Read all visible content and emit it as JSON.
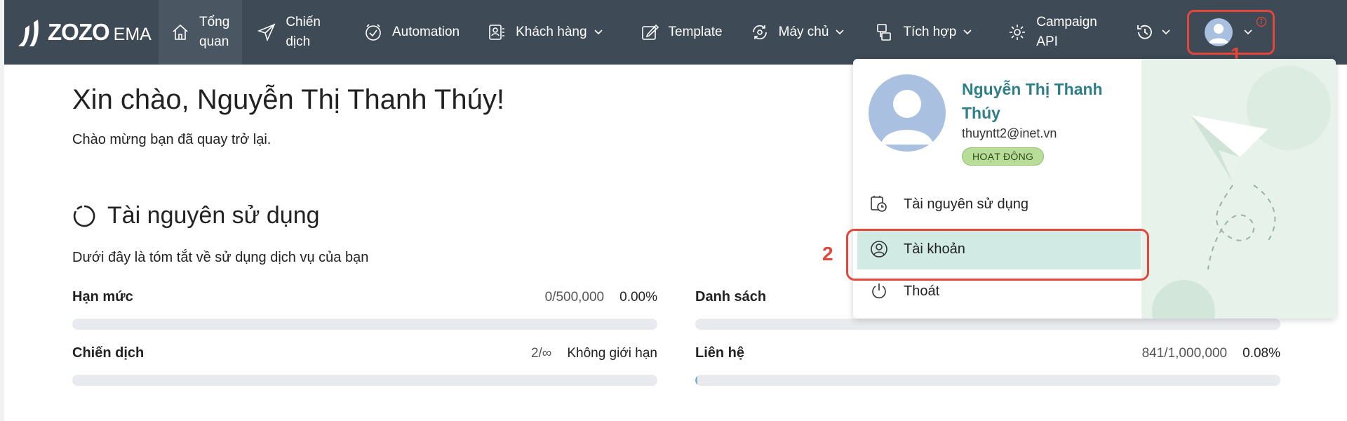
{
  "brand": {
    "name": "ZOZO",
    "suffix": "EMA"
  },
  "nav": [
    {
      "label": "Tổng\nquan",
      "line1": "Tổng",
      "line2": "quan",
      "icon": "home-icon",
      "active": true
    },
    {
      "label": "Chiến dịch",
      "line1": "Chiến",
      "line2": "dịch",
      "icon": "send-icon"
    },
    {
      "label": "Automation",
      "icon": "clock-check-icon"
    },
    {
      "label": "Khách hàng",
      "icon": "contacts-icon",
      "dropdown": true
    },
    {
      "label": "Template",
      "icon": "edit-icon"
    },
    {
      "label": "Máy chủ",
      "icon": "server-sync-icon",
      "dropdown": true
    },
    {
      "label": "Tích hợp",
      "icon": "integration-icon",
      "dropdown": true
    },
    {
      "label": "Campaign API",
      "line1": "Campaign",
      "line2": "API",
      "icon": "gear-api-icon"
    }
  ],
  "annotations": {
    "marker1": "1",
    "marker2": "2"
  },
  "greeting": "Xin chào, Nguyễn Thị Thanh Thúy!",
  "welcome": "Chào mừng bạn đã quay trở lại.",
  "resources": {
    "title": "Tài nguyên sử dụng",
    "description": "Dưới đây là tóm tắt về sử dụng dịch vụ của bạn",
    "stats": [
      {
        "name": "Hạn mức",
        "value": "0/500,000",
        "percent": "0.00%",
        "fill": 0.0
      },
      {
        "name": "Danh sách",
        "value": "",
        "percent": "",
        "fill": 0.0
      },
      {
        "name": "Chiến dịch",
        "value": "2/∞",
        "percent": "Không giới hạn",
        "fill": 0.0
      },
      {
        "name": "Liên hệ",
        "value": "841/1,000,000",
        "percent": "0.08%",
        "fill": 0.0008
      }
    ]
  },
  "user_menu": {
    "name": "Nguyễn Thị Thanh Thúy",
    "email": "thuyntt2@inet.vn",
    "status": "HOẠT ĐỘNG",
    "items": [
      {
        "label": "Tài nguyên sử dụng",
        "icon": "usage-clock-icon"
      },
      {
        "label": "Tài khoản",
        "icon": "user-circle-icon",
        "active": true
      },
      {
        "label": "Thoát",
        "icon": "power-icon"
      }
    ]
  },
  "colors": {
    "navbar": "#3e4a55",
    "accent": "#2f7f8a",
    "annotation": "#e5463a",
    "active_item": "#d1ebe4",
    "badge": "#b7dd99"
  }
}
